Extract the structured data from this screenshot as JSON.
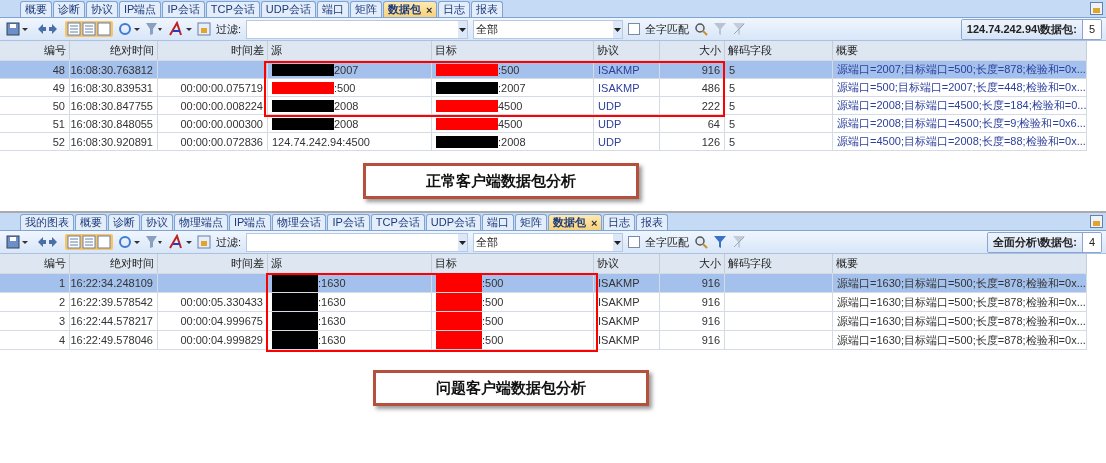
{
  "panels": [
    {
      "tabs": [
        {
          "label": "概要",
          "selected": false
        },
        {
          "label": "诊断",
          "selected": false
        },
        {
          "label": "协议",
          "selected": false
        },
        {
          "label": "IP端点",
          "selected": false
        },
        {
          "label": "IP会话",
          "selected": false
        },
        {
          "label": "TCP会话",
          "selected": false
        },
        {
          "label": "UDP会话",
          "selected": false
        },
        {
          "label": "端口",
          "selected": false
        },
        {
          "label": "矩阵",
          "selected": false
        },
        {
          "label": "数据包",
          "selected": true,
          "close_glyph": "×"
        },
        {
          "label": "日志",
          "selected": false
        },
        {
          "label": "报表",
          "selected": false
        }
      ],
      "toolbar": {
        "filter_label": "过滤:",
        "scope": "全部",
        "whole_word_label": "全字匹配",
        "whole_word_checked": false,
        "source_label": "124.74.242.94\\数据包:",
        "count": "5"
      },
      "columns": [
        {
          "label": "编号",
          "tinted": false
        },
        {
          "label": "绝对时间",
          "tinted": false
        },
        {
          "label": "时间差",
          "tinted": false
        },
        {
          "label": "源",
          "tinted": false
        },
        {
          "label": "目标",
          "tinted": false
        },
        {
          "label": "协议",
          "tinted": true
        },
        {
          "label": "大小",
          "tinted": false
        },
        {
          "label": "解码字段",
          "tinted": false
        },
        {
          "label": "概要",
          "tinted": true
        }
      ],
      "rows": [
        {
          "selected": true,
          "cells": [
            "48",
            "16:08:30.763812",
            null,
            {
              "text": "2007",
              "color": "#000000"
            },
            {
              "text": ":500",
              "color": "#ff0000"
            },
            "ISAKMP",
            "916",
            "5",
            "源端口=2007;目标端口=500;长度=878;检验和=0x..."
          ]
        },
        {
          "selected": false,
          "cells": [
            "49",
            "16:08:30.839531",
            "00:00:00.075719",
            {
              "text": ":500",
              "color": "#ff0000"
            },
            {
              "text": ":2007",
              "color": "#000000"
            },
            "ISAKMP",
            "486",
            "5",
            "源端口=500;目标端口=2007;长度=448;检验和=0x..."
          ]
        },
        {
          "selected": false,
          "cells": [
            "50",
            "16:08:30.847755",
            "00:00:00.008224",
            {
              "text": "2008",
              "color": "#000000"
            },
            {
              "text": "4500",
              "color": "#ff0000"
            },
            "UDP",
            "222",
            "5",
            "源端口=2008;目标端口=4500;长度=184;检验和=0..."
          ]
        },
        {
          "selected": false,
          "cells": [
            "51",
            "16:08:30.848055",
            "00:00:00.000300",
            {
              "text": "2008",
              "color": "#000000"
            },
            {
              "text": "4500",
              "color": "#ff0000"
            },
            "UDP",
            "64",
            "5",
            "源端口=2008;目标端口=4500;长度=9;检验和=0x6..."
          ]
        },
        {
          "selected": false,
          "cells": [
            "52",
            "16:08:30.920891",
            "00:00:00.072836",
            "124.74.242.94:4500",
            {
              "text": ":2008",
              "color": "#000000"
            },
            "UDP",
            "126",
            "5",
            "源端口=4500;目标端口=2008;长度=88;检验和=0x..."
          ]
        }
      ],
      "caption": "正常客户端数据包分析"
    },
    {
      "tabs": [
        {
          "label": "我的图表",
          "selected": false
        },
        {
          "label": "概要",
          "selected": false
        },
        {
          "label": "诊断",
          "selected": false
        },
        {
          "label": "协议",
          "selected": false
        },
        {
          "label": "物理端点",
          "selected": false
        },
        {
          "label": "IP端点",
          "selected": false
        },
        {
          "label": "物理会话",
          "selected": false
        },
        {
          "label": "IP会话",
          "selected": false
        },
        {
          "label": "TCP会话",
          "selected": false
        },
        {
          "label": "UDP会话",
          "selected": false
        },
        {
          "label": "端口",
          "selected": false
        },
        {
          "label": "矩阵",
          "selected": false
        },
        {
          "label": "数据包",
          "selected": true,
          "close_glyph": "×"
        },
        {
          "label": "日志",
          "selected": false
        },
        {
          "label": "报表",
          "selected": false
        }
      ],
      "toolbar": {
        "filter_label": "过滤:",
        "scope": "全部",
        "whole_word_label": "全字匹配",
        "whole_word_checked": false,
        "source_label": "全面分析\\数据包:",
        "count": "4"
      },
      "columns": [
        {
          "label": "编号",
          "tinted": false
        },
        {
          "label": "绝对时间",
          "tinted": false
        },
        {
          "label": "时间差",
          "tinted": false
        },
        {
          "label": "源",
          "tinted": false
        },
        {
          "label": "目标",
          "tinted": false
        },
        {
          "label": "协议",
          "tinted": false
        },
        {
          "label": "大小",
          "tinted": false
        },
        {
          "label": "解码字段"
        },
        {
          "label": "概要",
          "tinted": false
        }
      ],
      "rows": [
        {
          "selected": true,
          "cells": [
            "1",
            "16:22:34.248109",
            null,
            {
              "text": ":1630",
              "color": "#000000"
            },
            {
              "text": ":500",
              "color": "#ff0000"
            },
            "ISAKMP",
            "916",
            null,
            "源端口=1630;目标端口=500;长度=878;检验和=0x..."
          ]
        },
        {
          "selected": false,
          "cells": [
            "2",
            "16:22:39.578542",
            "00:00:05.330433",
            {
              "text": ":1630",
              "color": "#000000"
            },
            {
              "text": ":500",
              "color": "#ff0000"
            },
            "ISAKMP",
            "916",
            null,
            "源端口=1630;目标端口=500;长度=878;检验和=0x..."
          ]
        },
        {
          "selected": false,
          "cells": [
            "3",
            "16:22:44.578217",
            "00:00:04.999675",
            {
              "text": ":1630",
              "color": "#000000"
            },
            {
              "text": ":500",
              "color": "#ff0000"
            },
            "ISAKMP",
            "916",
            null,
            "源端口=1630;目标端口=500;长度=878;检验和=0x..."
          ]
        },
        {
          "selected": false,
          "cells": [
            "4",
            "16:22:49.578046",
            "00:00:04.999829",
            {
              "text": ":1630",
              "color": "#000000"
            },
            {
              "text": ":500",
              "color": "#ff0000"
            },
            "ISAKMP",
            "916",
            null,
            "源端口=1630;目标端口=500;长度=878;检验和=0x..."
          ]
        }
      ],
      "caption": "问题客户端数据包分析"
    }
  ]
}
